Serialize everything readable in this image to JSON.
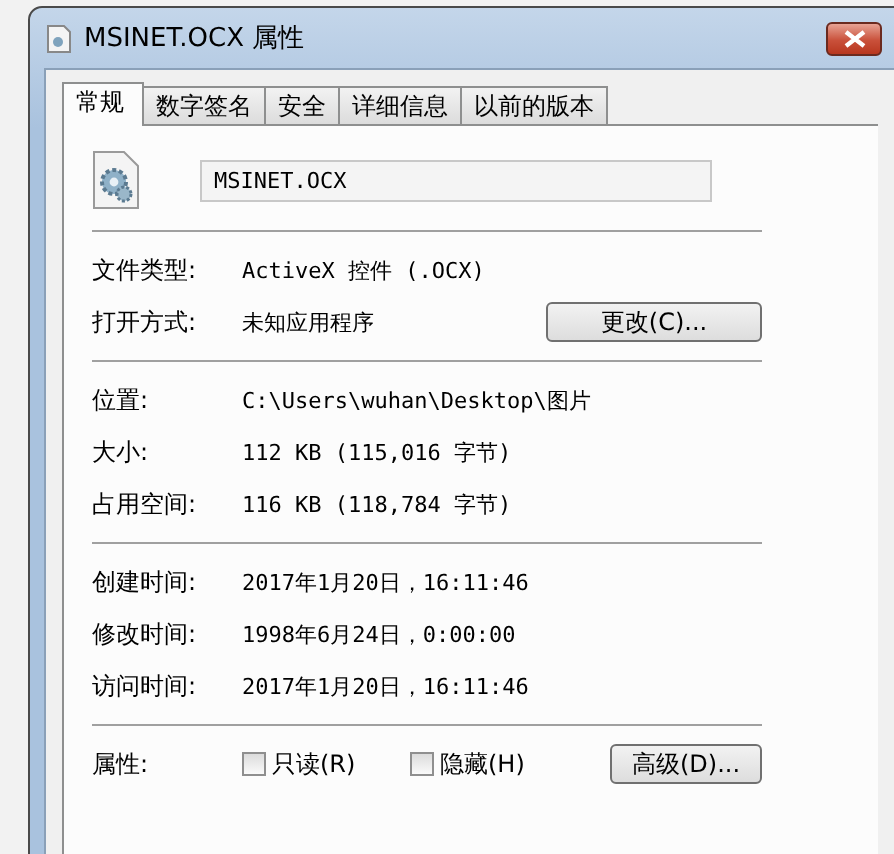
{
  "window": {
    "title": "MSINET.OCX 属性"
  },
  "tabs": [
    {
      "label": "常规",
      "selected": true
    },
    {
      "label": "数字签名",
      "selected": false
    },
    {
      "label": "安全",
      "selected": false
    },
    {
      "label": "详细信息",
      "selected": false
    },
    {
      "label": "以前的版本",
      "selected": false
    }
  ],
  "file_name": {
    "value": "MSINET.OCX"
  },
  "sections": [
    {
      "rows": [
        {
          "label": "文件类型:",
          "value": "ActiveX 控件 (.OCX)"
        },
        {
          "label": "打开方式:",
          "value": "未知应用程序",
          "button": "更改(C)..."
        }
      ]
    },
    {
      "rows": [
        {
          "label": "位置:",
          "value": "C:\\Users\\wuhan\\Desktop\\图片"
        },
        {
          "label": "大小:",
          "value": "112 KB (115,016 字节)"
        },
        {
          "label": "占用空间:",
          "value": "116 KB (118,784 字节)"
        }
      ]
    },
    {
      "rows": [
        {
          "label": "创建时间:",
          "value": "2017年1月20日，16:11:46"
        },
        {
          "label": "修改时间:",
          "value": "1998年6月24日，0:00:00"
        },
        {
          "label": "访问时间:",
          "value": "2017年1月20日，16:11:46"
        }
      ]
    }
  ],
  "attributes": {
    "label": "属性:",
    "checkboxes": [
      {
        "label": "只读(R)",
        "checked": false
      },
      {
        "label": "隐藏(H)",
        "checked": false
      }
    ],
    "button": "高级(D)..."
  }
}
